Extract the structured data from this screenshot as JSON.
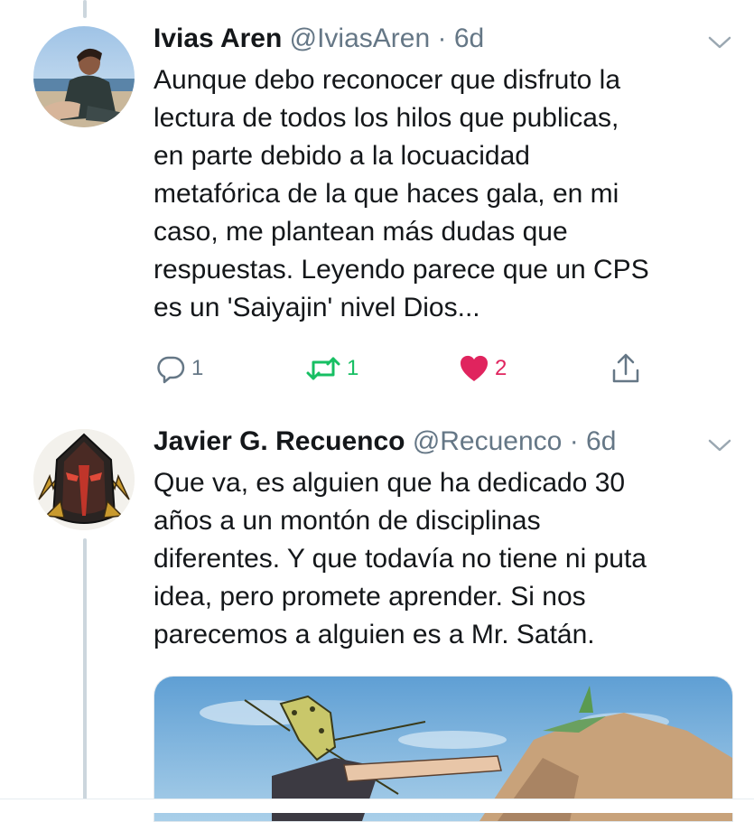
{
  "colors": {
    "text": "#14171a",
    "muted": "#657786",
    "reply": "#657786",
    "retweet": "#17bf63",
    "like": "#e0245e",
    "thread_line": "#ccd6dd"
  },
  "tweets": [
    {
      "author_name": "Ivias Aren",
      "handle": "@IviasAren",
      "separator": "·",
      "time": "6d",
      "body_lines": [
        "Aunque debo reconocer que disfruto la",
        "lectura de todos los hilos que publicas,",
        "en parte debido a la locuacidad",
        "metafórica de la que haces gala, en mi",
        "caso, me plantean más dudas que",
        "respuestas. Leyendo parece que un CPS",
        "es un 'Saiyajin' nivel Dios..."
      ],
      "actions": {
        "reply_count": "1",
        "retweet_count": "1",
        "like_count": "2"
      },
      "icons": [
        "reply-icon",
        "retweet-icon",
        "heart-icon",
        "share-icon",
        "chevron-down-icon"
      ]
    },
    {
      "author_name": "Javier G. Recuenco",
      "handle": "@Recuenco",
      "separator": "·",
      "time": "6d",
      "body_lines": [
        "Que va, es alguien que ha dedicado 30",
        "años a un montón de disciplinas",
        "diferentes. Y que todavía no tiene ni puta",
        "idea, pero promete aprender. Si nos",
        "parecemos a alguien es a Mr. Satán."
      ],
      "icons": [
        "chevron-down-icon"
      ]
    }
  ]
}
